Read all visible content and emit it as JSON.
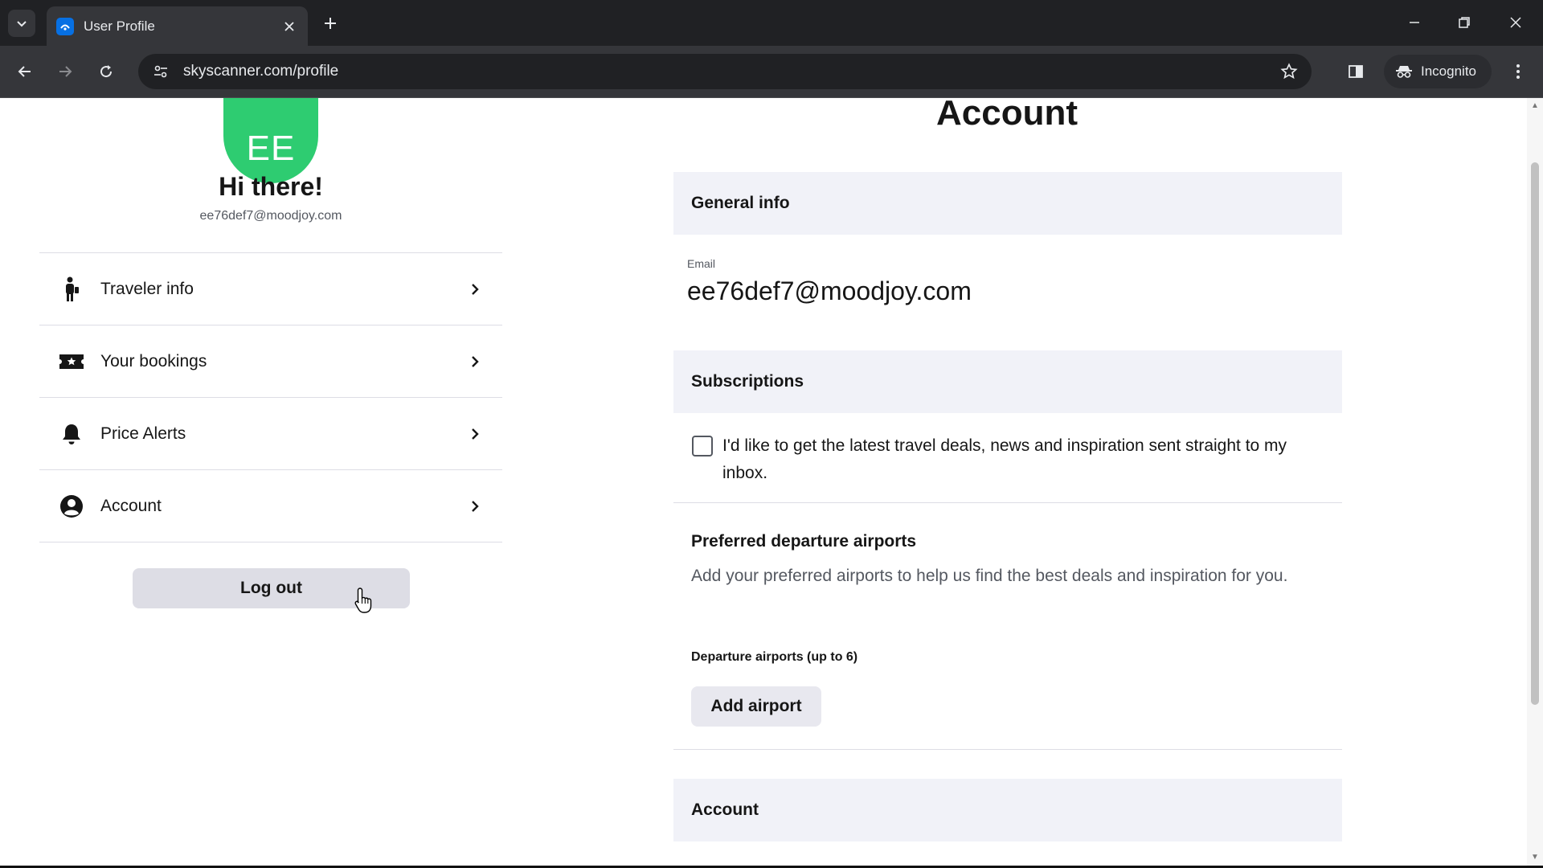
{
  "browser": {
    "tab_title": "User Profile",
    "url": "skyscanner.com/profile",
    "incognito_label": "Incognito"
  },
  "profile": {
    "initials": "EE",
    "greeting": "Hi there!",
    "email": "ee76def7@moodjoy.com",
    "avatar_color": "#2ecc71"
  },
  "nav": {
    "items": [
      {
        "label": "Traveler info",
        "icon": "traveler-icon"
      },
      {
        "label": "Your bookings",
        "icon": "ticket-icon"
      },
      {
        "label": "Price Alerts",
        "icon": "bell-icon"
      },
      {
        "label": "Account",
        "icon": "account-circle-icon"
      }
    ],
    "logout_label": "Log out"
  },
  "main": {
    "title": "Account",
    "general_info": {
      "heading": "General info",
      "email_label": "Email",
      "email_value": "ee76def7@moodjoy.com"
    },
    "subscriptions": {
      "heading": "Subscriptions",
      "checkbox_label": "I'd like to get the latest travel deals, news and inspiration sent straight to my inbox.",
      "checked": false
    },
    "airports": {
      "heading": "Preferred departure airports",
      "description": "Add your preferred airports to help us find the best deals and inspiration for you.",
      "field_label": "Departure airports (up to 6)",
      "add_button": "Add airport"
    },
    "account_section": {
      "heading": "Account"
    }
  }
}
